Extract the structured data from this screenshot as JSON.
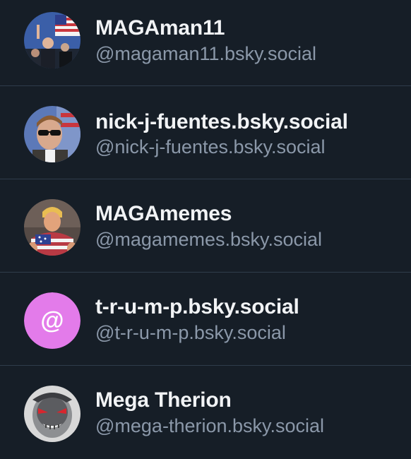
{
  "accounts": [
    {
      "display_name": "MAGAman11",
      "handle": "@magaman11.bsky.social",
      "avatar": "photo-avatar-flag"
    },
    {
      "display_name": "nick-j-fuentes.bsky.social",
      "handle": "@nick-j-fuentes.bsky.social",
      "avatar": "photo-avatar-sunglasses"
    },
    {
      "display_name": "MAGAmemes",
      "handle": "@magamemes.bsky.social",
      "avatar": "photo-avatar-flag-shirt"
    },
    {
      "display_name": "t-r-u-m-p.bsky.social",
      "handle": "@t-r-u-m-p.bsky.social",
      "avatar": "default-at-avatar",
      "avatar_color": "#e37bea"
    },
    {
      "display_name": "Mega Therion",
      "handle": "@mega-therion.bsky.social",
      "avatar": "photo-avatar-monster"
    }
  ],
  "colors": {
    "background": "#161e27",
    "divider": "#2f3c4b",
    "name_text": "#f1f3f5",
    "handle_text": "#8b98a9"
  }
}
